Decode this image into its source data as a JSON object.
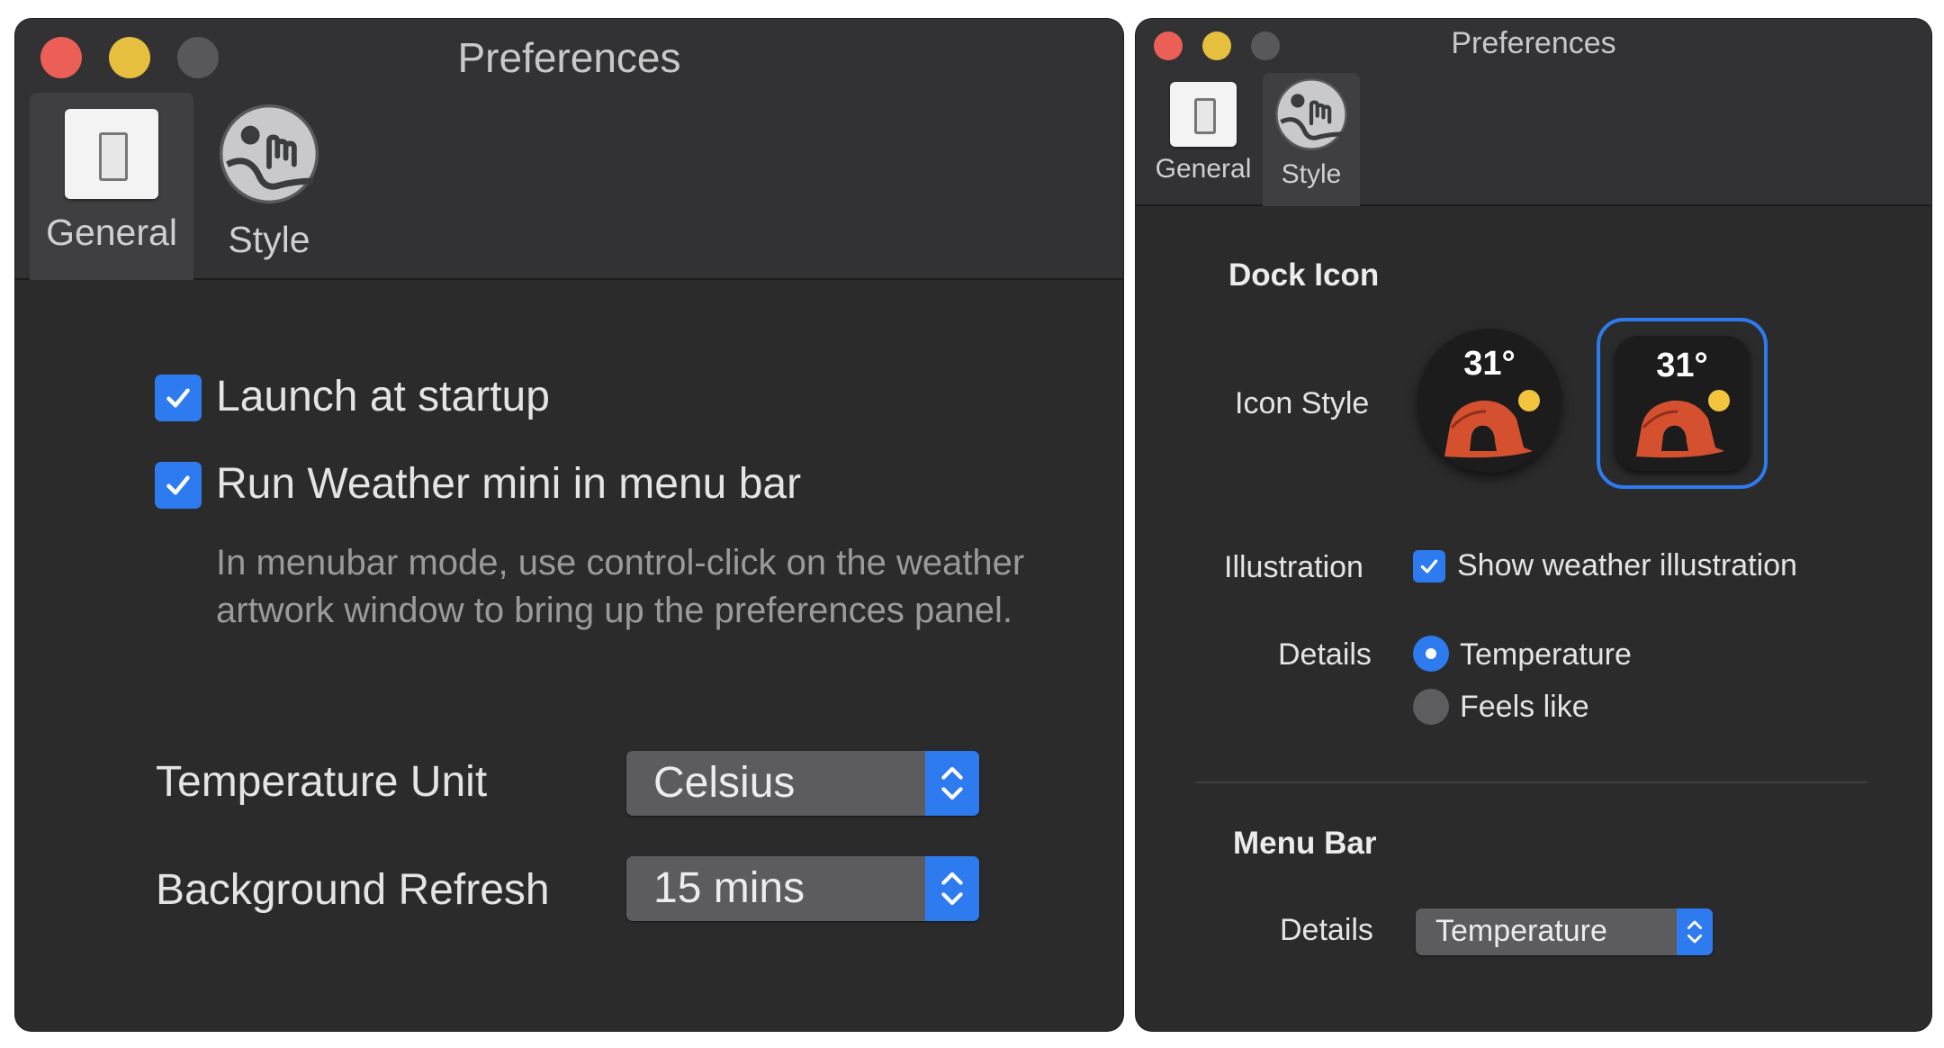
{
  "left_window": {
    "title": "Preferences",
    "toolbar": {
      "items": [
        {
          "label": "General",
          "selected": true
        },
        {
          "label": "Style",
          "selected": false
        }
      ]
    },
    "options": {
      "launch_at_startup": {
        "label": "Launch at startup",
        "checked": true
      },
      "run_in_menu_bar": {
        "label": "Run Weather mini in menu bar",
        "checked": true
      },
      "note": "In menubar mode, use control-click on the weather artwork window to bring up the preferences panel."
    },
    "temperature_unit": {
      "label": "Temperature Unit",
      "value": "Celsius"
    },
    "background_refresh": {
      "label": "Background Refresh",
      "value": "15 mins"
    }
  },
  "right_window": {
    "title": "Preferences",
    "toolbar": {
      "items": [
        {
          "label": "General",
          "selected": false
        },
        {
          "label": "Style",
          "selected": true
        }
      ]
    },
    "dock_icon": {
      "section_title": "Dock Icon",
      "icon_style_label": "Icon Style",
      "icon_options": [
        {
          "temp": "31°",
          "shape": "round",
          "selected": false
        },
        {
          "temp": "31°",
          "shape": "rounded-square",
          "selected": true
        }
      ],
      "illustration_label": "Illustration",
      "illustration_checkbox": {
        "label": "Show weather illustration",
        "checked": true
      },
      "details_label": "Details",
      "details_options": [
        {
          "label": "Temperature",
          "selected": true
        },
        {
          "label": "Feels like",
          "selected": false
        }
      ]
    },
    "menu_bar": {
      "section_title": "Menu Bar",
      "details_label": "Details",
      "details_value": "Temperature"
    }
  },
  "colors": {
    "window_bg": "#2b2b2c",
    "accent": "#2e7bf0",
    "close": "#ec5f57",
    "minimize": "#e5bf3d",
    "zoom_inactive": "#58585a",
    "sun": "#f3c43d",
    "arch": "#d4502f"
  },
  "icons": {
    "general": "switch-icon",
    "style": "weather-style-icon",
    "checkbox": "checkmark-icon",
    "stepper": "chevron-updown-icon"
  }
}
